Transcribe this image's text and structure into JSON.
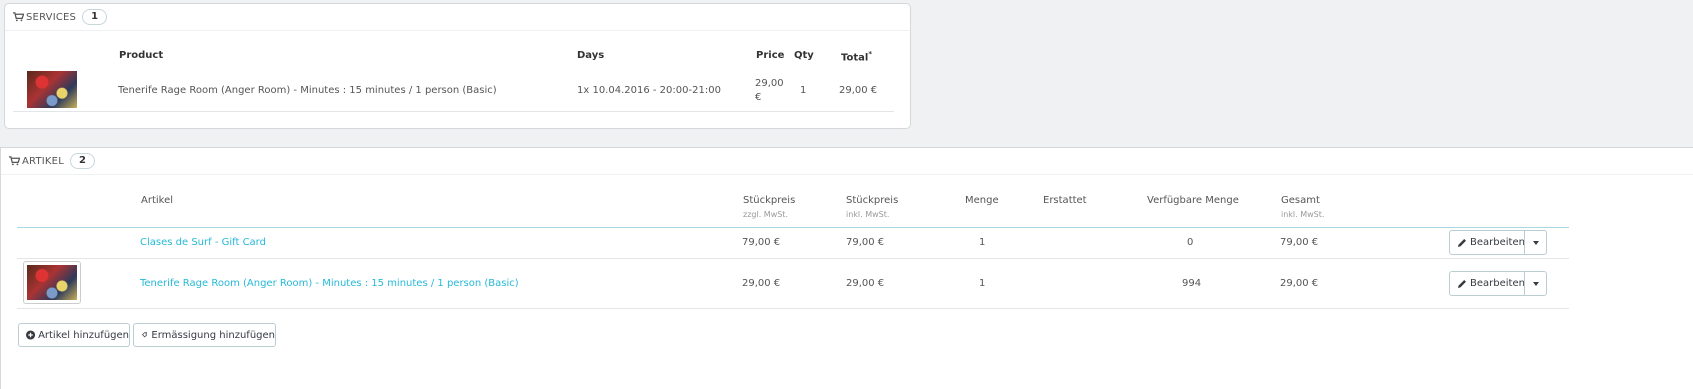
{
  "services": {
    "title": "Services",
    "count": "1",
    "headers": {
      "product": "Product",
      "days": "Days",
      "price": "Price",
      "qty": "Qty",
      "total": "Total",
      "total_mark": "*"
    },
    "rows": [
      {
        "product": "Tenerife Rage Room (Anger Room) - Minutes : 15 minutes / 1 person (Basic)",
        "days": "1x 10.04.2016 - 20:00-21:00",
        "price_line1": "29,00",
        "price_line2": "€",
        "qty": "1",
        "total": "29,00 €"
      }
    ]
  },
  "artikel": {
    "title": "Artikel",
    "count": "2",
    "headers": {
      "artikel": "Artikel",
      "stueckpreis_excl": "Stückpreis",
      "stueckpreis_excl_sub": "zzgl. MwSt.",
      "stueckpreis_incl": "Stückpreis",
      "stueckpreis_incl_sub": "inkl. MwSt.",
      "menge": "Menge",
      "erstattet": "Erstattet",
      "verfuegbar": "Verfügbare Menge",
      "gesamt": "Gesamt",
      "gesamt_sub": "inkl. MwSt."
    },
    "rows": [
      {
        "name": "Clases de Surf - Gift Card",
        "price_excl": "79,00 €",
        "price_incl": "79,00 €",
        "qty": "1",
        "available": "0",
        "total": "79,00 €",
        "edit": "Bearbeiten"
      },
      {
        "name": "Tenerife Rage Room (Anger Room) - Minutes : 15 minutes / 1 person (Basic)",
        "price_excl": "29,00 €",
        "price_incl": "29,00 €",
        "qty": "1",
        "available": "994",
        "total": "29,00 €",
        "edit": "Bearbeiten"
      }
    ],
    "buttons": {
      "add_product": "Artikel hinzufügen",
      "add_discount": "Ermässigung hinzufügen"
    }
  },
  "colors": {
    "link": "#25b9d7",
    "background": "#eff1f2"
  }
}
